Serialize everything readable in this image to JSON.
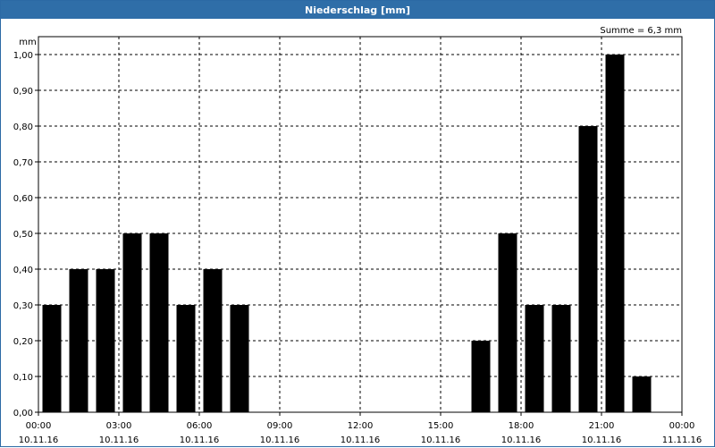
{
  "window": {
    "title": "Niederschlag [mm]"
  },
  "chart_data": {
    "type": "bar",
    "title": "Niederschlag [mm]",
    "ylabel": "mm",
    "summary": "Summe = 6,3 mm",
    "ylim": [
      0,
      1.0
    ],
    "y_ticks": [
      "0,00",
      "0,10",
      "0,20",
      "0,30",
      "0,40",
      "0,50",
      "0,60",
      "0,70",
      "0,80",
      "0,90",
      "1,00"
    ],
    "x_ticks": [
      {
        "time": "00:00",
        "date": "10.11.16"
      },
      {
        "time": "03:00",
        "date": "10.11.16"
      },
      {
        "time": "06:00",
        "date": "10.11.16"
      },
      {
        "time": "09:00",
        "date": "10.11.16"
      },
      {
        "time": "12:00",
        "date": "10.11.16"
      },
      {
        "time": "15:00",
        "date": "10.11.16"
      },
      {
        "time": "18:00",
        "date": "10.11.16"
      },
      {
        "time": "21:00",
        "date": "10.11.16"
      },
      {
        "time": "00:00",
        "date": "11.11.16"
      }
    ],
    "x_range_hours": [
      0,
      24
    ],
    "grid": true,
    "bar_color": "#000000",
    "hour_start": [
      0,
      1,
      2,
      3,
      4,
      5,
      6,
      7,
      8,
      9,
      10,
      11,
      12,
      13,
      14,
      15,
      16,
      17,
      18,
      19,
      20,
      21,
      22,
      23
    ],
    "values": [
      0.3,
      0.4,
      0.4,
      0.5,
      0.5,
      0.3,
      0.4,
      0.3,
      0,
      0,
      0,
      0,
      0,
      0,
      0,
      0,
      0.2,
      0.5,
      0.3,
      0.3,
      0.8,
      1.0,
      0.1,
      0
    ]
  }
}
